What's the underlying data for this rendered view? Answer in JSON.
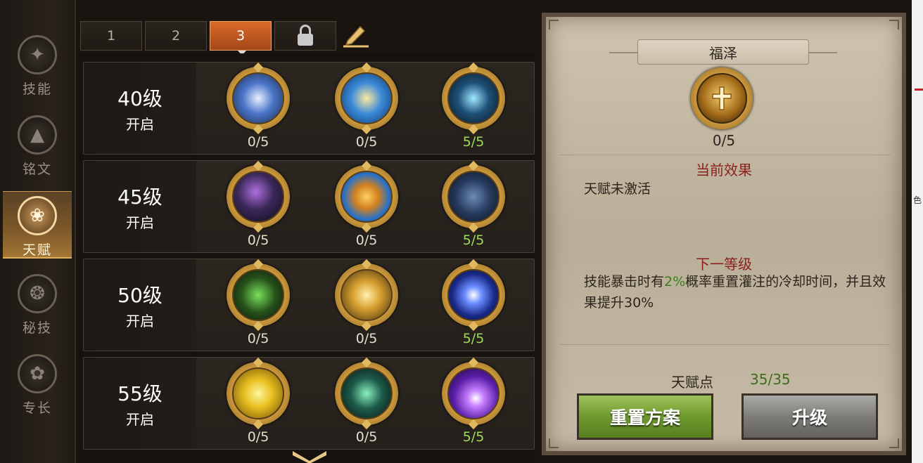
{
  "nav": {
    "items": [
      {
        "label": "技能",
        "icon": "book-icon",
        "active": false
      },
      {
        "label": "铭文",
        "icon": "triangle-sigil-icon",
        "active": false
      },
      {
        "label": "天赋",
        "icon": "lotus-icon",
        "active": true
      },
      {
        "label": "秘技",
        "icon": "spiral-flame-icon",
        "active": false
      },
      {
        "label": "专长",
        "icon": "flower-crest-icon",
        "active": false
      }
    ]
  },
  "tabs": {
    "items": [
      {
        "label": "1",
        "active": false
      },
      {
        "label": "2",
        "active": false
      },
      {
        "label": "3",
        "active": true
      }
    ],
    "lock_icon": "lock-icon",
    "edit_icon": "pencil-icon"
  },
  "talent_rows": [
    {
      "level": "40级",
      "open": "开启",
      "talents": [
        {
          "name": "lightning-body-icon",
          "progress": "0/5",
          "maxed": false
        },
        {
          "name": "winged-shield-icon",
          "progress": "0/5",
          "maxed": false
        },
        {
          "name": "shadow-figure-icon",
          "progress": "5/5",
          "maxed": true
        }
      ]
    },
    {
      "level": "45级",
      "open": "开启",
      "talents": [
        {
          "name": "dark-sorceress-icon",
          "progress": "0/5",
          "maxed": false
        },
        {
          "name": "golden-shield-icon",
          "progress": "0/5",
          "maxed": false
        },
        {
          "name": "hooded-mage-icon",
          "progress": "5/5",
          "maxed": true
        }
      ]
    },
    {
      "level": "50级",
      "open": "开启",
      "talents": [
        {
          "name": "green-warrior-icon",
          "progress": "0/5",
          "maxed": false
        },
        {
          "name": "golden-angel-icon",
          "progress": "0/5",
          "maxed": false
        },
        {
          "name": "blue-vortex-icon",
          "progress": "5/5",
          "maxed": true
        }
      ]
    },
    {
      "level": "55级",
      "open": "开启",
      "talents": [
        {
          "name": "golden-heart-icon",
          "progress": "0/5",
          "maxed": false
        },
        {
          "name": "green-spirit-icon",
          "progress": "0/5",
          "maxed": false
        },
        {
          "name": "purple-orb-icon",
          "progress": "5/5",
          "maxed": true
        }
      ]
    }
  ],
  "detail": {
    "title": "福泽",
    "icon": "golden-cross-icon",
    "progress": "0/5",
    "current_title": "当前效果",
    "current_text": "天赋未激活",
    "next_title": "下一等级",
    "next_text_pre": "技能暴击时有",
    "next_text_hl": "2%",
    "next_text_post": "概率重置灌注的冷却时间，并且效果提升30%",
    "points_label": "天赋点",
    "points_value": "35/35",
    "reset_label": "重置方案",
    "upgrade_label": "升级"
  },
  "colors": {
    "active_tab": "#d96a2a",
    "maxed_green": "#9fdc5a",
    "section_red": "#8b1e1e",
    "reset_green": "#6f9a2e",
    "upgrade_gray": "#7d7c78"
  },
  "edge": {
    "char": "色"
  }
}
